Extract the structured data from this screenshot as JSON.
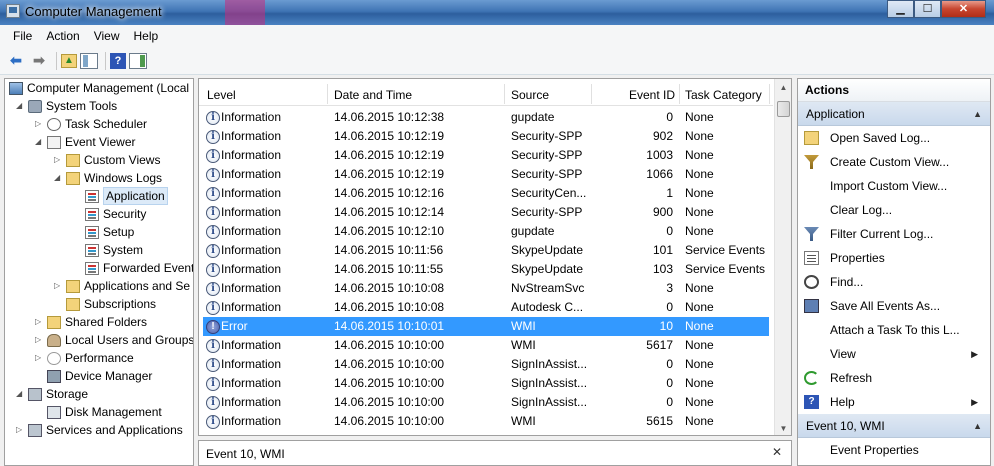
{
  "window": {
    "title": "Computer Management"
  },
  "menu": [
    "File",
    "Action",
    "View",
    "Help"
  ],
  "toolbar": {
    "icons": [
      "back-arrow-icon",
      "forward-arrow-icon",
      "up-folder-icon",
      "show-hide-tree-icon",
      "help-icon",
      "show-hide-action-pane-icon"
    ]
  },
  "tree": [
    {
      "label": "Computer Management (Local",
      "level": 0,
      "icon": "computer",
      "expander": ""
    },
    {
      "label": "System Tools",
      "level": 1,
      "icon": "tools",
      "expander": "◢"
    },
    {
      "label": "Task Scheduler",
      "level": 2,
      "icon": "clock",
      "expander": "▷"
    },
    {
      "label": "Event Viewer",
      "level": 2,
      "icon": "viewer",
      "expander": "◢"
    },
    {
      "label": "Custom Views",
      "level": 3,
      "icon": "folder",
      "expander": "▷"
    },
    {
      "label": "Windows Logs",
      "level": 3,
      "icon": "folder",
      "expander": "◢"
    },
    {
      "label": "Application",
      "level": 4,
      "icon": "log",
      "expander": "",
      "selected": true
    },
    {
      "label": "Security",
      "level": 4,
      "icon": "log",
      "expander": ""
    },
    {
      "label": "Setup",
      "level": 4,
      "icon": "log",
      "expander": ""
    },
    {
      "label": "System",
      "level": 4,
      "icon": "log",
      "expander": ""
    },
    {
      "label": "Forwarded Event",
      "level": 4,
      "icon": "log",
      "expander": ""
    },
    {
      "label": "Applications and Se",
      "level": 3,
      "icon": "folder",
      "expander": "▷"
    },
    {
      "label": "Subscriptions",
      "level": 3,
      "icon": "folder",
      "expander": ""
    },
    {
      "label": "Shared Folders",
      "level": 2,
      "icon": "share",
      "expander": "▷"
    },
    {
      "label": "Local Users and Groups",
      "level": 2,
      "icon": "users",
      "expander": "▷"
    },
    {
      "label": "Performance",
      "level": 2,
      "icon": "perf",
      "expander": "▷"
    },
    {
      "label": "Device Manager",
      "level": 2,
      "icon": "device",
      "expander": ""
    },
    {
      "label": "Storage",
      "level": 1,
      "icon": "storage",
      "expander": "◢"
    },
    {
      "label": "Disk Management",
      "level": 2,
      "icon": "disk",
      "expander": ""
    },
    {
      "label": "Services and Applications",
      "level": 1,
      "icon": "services",
      "expander": "▷"
    }
  ],
  "events": {
    "columns": [
      "Level",
      "Date and Time",
      "Source",
      "Event ID",
      "Task Category"
    ],
    "rows": [
      [
        "Information",
        "14.06.2015 10:12:38",
        "gupdate",
        "0",
        "None"
      ],
      [
        "Information",
        "14.06.2015 10:12:19",
        "Security-SPP",
        "902",
        "None"
      ],
      [
        "Information",
        "14.06.2015 10:12:19",
        "Security-SPP",
        "1003",
        "None"
      ],
      [
        "Information",
        "14.06.2015 10:12:19",
        "Security-SPP",
        "1066",
        "None"
      ],
      [
        "Information",
        "14.06.2015 10:12:16",
        "SecurityCen...",
        "1",
        "None"
      ],
      [
        "Information",
        "14.06.2015 10:12:14",
        "Security-SPP",
        "900",
        "None"
      ],
      [
        "Information",
        "14.06.2015 10:12:10",
        "gupdate",
        "0",
        "None"
      ],
      [
        "Information",
        "14.06.2015 10:11:56",
        "SkypeUpdate",
        "101",
        "Service Events"
      ],
      [
        "Information",
        "14.06.2015 10:11:55",
        "SkypeUpdate",
        "103",
        "Service Events"
      ],
      [
        "Information",
        "14.06.2015 10:10:08",
        "NvStreamSvc",
        "3",
        "None"
      ],
      [
        "Information",
        "14.06.2015 10:10:08",
        "Autodesk C...",
        "0",
        "None"
      ],
      [
        "Error",
        "14.06.2015 10:10:01",
        "WMI",
        "10",
        "None"
      ],
      [
        "Information",
        "14.06.2015 10:10:00",
        "WMI",
        "5617",
        "None"
      ],
      [
        "Information",
        "14.06.2015 10:10:00",
        "SignInAssist...",
        "0",
        "None"
      ],
      [
        "Information",
        "14.06.2015 10:10:00",
        "SignInAssist...",
        "0",
        "None"
      ],
      [
        "Information",
        "14.06.2015 10:10:00",
        "SignInAssist...",
        "0",
        "None"
      ],
      [
        "Information",
        "14.06.2015 10:10:00",
        "WMI",
        "5615",
        "None"
      ]
    ],
    "selected_index": 11
  },
  "detail": {
    "title": "Event 10, WMI",
    "close": "✕"
  },
  "actions": {
    "header": "Actions",
    "sections": [
      {
        "title": "Application",
        "items": [
          {
            "label": "Open Saved Log...",
            "icon": "open"
          },
          {
            "label": "Create Custom View...",
            "icon": "filter"
          },
          {
            "label": "Import Custom View...",
            "icon": ""
          },
          {
            "label": "Clear Log...",
            "icon": ""
          },
          {
            "label": "Filter Current Log...",
            "icon": "filter2"
          },
          {
            "label": "Properties",
            "icon": "props"
          },
          {
            "label": "Find...",
            "icon": "find"
          },
          {
            "label": "Save All Events As...",
            "icon": "save"
          },
          {
            "label": "Attach a Task To this L...",
            "icon": ""
          },
          {
            "label": "View",
            "icon": "",
            "submenu": true
          },
          {
            "label": "Refresh",
            "icon": "refresh"
          },
          {
            "label": "Help",
            "icon": "help",
            "submenu": true
          }
        ]
      },
      {
        "title": "Event 10, WMI",
        "items": [
          {
            "label": "Event Properties",
            "icon": ""
          }
        ]
      }
    ]
  },
  "colors": {
    "selection": "#3399ff",
    "titlebar": "#3f74b4",
    "section": "#c9d9ec"
  }
}
